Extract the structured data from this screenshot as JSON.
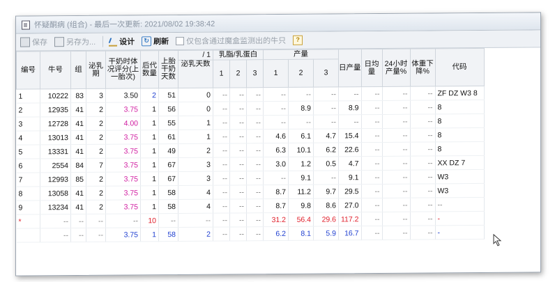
{
  "window": {
    "title": "怀疑酮病 (组合) - 最后一次更新: 2021/08/02 19:38:42"
  },
  "toolbar": {
    "save": "保存",
    "saveas": "另存为...",
    "design": "设计",
    "refresh": "刷新",
    "filter": "仅包含通过魔盒监测出的牛只",
    "help_icon": "question-mark"
  },
  "headers": {
    "bianhao": "编号",
    "niuhao": "牛号",
    "zu": "组",
    "miru": "泌乳期",
    "ganpi": "干奶时体况评分(上一胎次)",
    "houdai": "后代数量",
    "shangtai": "上胎干奶天数",
    "slash": "/ 1",
    "miru_days": "泌乳天数",
    "ratio_group": "乳脂/乳蛋白",
    "yield_group": "产量",
    "sub": [
      "1",
      "2",
      "3"
    ],
    "richan": "日产量",
    "rijun": "日均量",
    "h24": "24小时产量%",
    "tizhong": "体重下降%",
    "daima": "代码"
  },
  "rows": [
    {
      "no": "1",
      "cow": "10222",
      "grp": "83",
      "lac": "3",
      "bcs": "3.50",
      "off": "2",
      "dry": "51",
      "dim": "0",
      "r1": "--",
      "r2": "--",
      "r3": "--",
      "p1": "--",
      "p2": "--",
      "p3": "--",
      "day": "--",
      "avg": "--",
      "h24": "--",
      "wt": "--",
      "code": "ZF DZ W3 8",
      "bcsColor": "black",
      "offColor": "magenta"
    },
    {
      "no": "2",
      "cow": "12935",
      "grp": "41",
      "lac": "2",
      "bcs": "3.75",
      "off": "1",
      "dry": "56",
      "dim": "0",
      "r1": "--",
      "r2": "--",
      "r3": "--",
      "p1": "--",
      "p2": "8.9",
      "p3": "--",
      "day": "8.9",
      "avg": "--",
      "h24": "--",
      "wt": "--",
      "code": "8",
      "bcsColor": "magenta",
      "offColor": "black"
    },
    {
      "no": "3",
      "cow": "12728",
      "grp": "41",
      "lac": "2",
      "bcs": "4.00",
      "off": "1",
      "dry": "55",
      "dim": "1",
      "r1": "--",
      "r2": "--",
      "r3": "--",
      "p1": "--",
      "p2": "--",
      "p3": "--",
      "day": "--",
      "avg": "--",
      "h24": "--",
      "wt": "--",
      "code": "8",
      "bcsColor": "magenta",
      "offColor": "black"
    },
    {
      "no": "4",
      "cow": "13013",
      "grp": "41",
      "lac": "2",
      "bcs": "3.75",
      "off": "1",
      "dry": "61",
      "dim": "1",
      "r1": "--",
      "r2": "--",
      "r3": "--",
      "p1": "4.6",
      "p2": "6.1",
      "p3": "4.7",
      "day": "15.4",
      "avg": "--",
      "h24": "--",
      "wt": "--",
      "code": "8",
      "bcsColor": "magenta",
      "offColor": "black"
    },
    {
      "no": "5",
      "cow": "13331",
      "grp": "41",
      "lac": "2",
      "bcs": "3.75",
      "off": "1",
      "dry": "49",
      "dim": "2",
      "r1": "--",
      "r2": "--",
      "r3": "--",
      "p1": "6.3",
      "p2": "10.1",
      "p3": "6.2",
      "day": "22.6",
      "avg": "--",
      "h24": "--",
      "wt": "--",
      "code": "8",
      "bcsColor": "magenta",
      "offColor": "black"
    },
    {
      "no": "6",
      "cow": "2554",
      "grp": "84",
      "lac": "7",
      "bcs": "3.75",
      "off": "1",
      "dry": "67",
      "dim": "3",
      "r1": "--",
      "r2": "--",
      "r3": "--",
      "p1": "3.0",
      "p2": "1.2",
      "p3": "0.5",
      "day": "4.7",
      "avg": "--",
      "h24": "--",
      "wt": "--",
      "code": "XX DZ 7",
      "bcsColor": "magenta",
      "offColor": "black"
    },
    {
      "no": "7",
      "cow": "12993",
      "grp": "85",
      "lac": "2",
      "bcs": "3.75",
      "off": "1",
      "dry": "67",
      "dim": "3",
      "r1": "--",
      "r2": "--",
      "r3": "--",
      "p1": "--",
      "p2": "9.1",
      "p3": "--",
      "day": "9.1",
      "avg": "--",
      "h24": "--",
      "wt": "--",
      "code": "W3",
      "bcsColor": "magenta",
      "offColor": "black"
    },
    {
      "no": "8",
      "cow": "13058",
      "grp": "41",
      "lac": "2",
      "bcs": "3.75",
      "off": "1",
      "dry": "58",
      "dim": "4",
      "r1": "--",
      "r2": "--",
      "r3": "--",
      "p1": "8.7",
      "p2": "11.2",
      "p3": "9.7",
      "day": "29.5",
      "avg": "--",
      "h24": "--",
      "wt": "--",
      "code": "W3",
      "bcsColor": "magenta",
      "offColor": "black"
    },
    {
      "no": "9",
      "cow": "13234",
      "grp": "41",
      "lac": "2",
      "bcs": "3.75",
      "off": "1",
      "dry": "58",
      "dim": "4",
      "r1": "--",
      "r2": "--",
      "r3": "--",
      "p1": "8.7",
      "p2": "9.8",
      "p3": "8.6",
      "day": "27.0",
      "avg": "--",
      "h24": "--",
      "wt": "--",
      "code": "--",
      "bcsColor": "magenta",
      "offColor": "black"
    }
  ],
  "summary": {
    "total": {
      "no": "*",
      "cow": "--",
      "grp": "--",
      "lac": "--",
      "bcs": "--",
      "off": "10",
      "dry": "--",
      "dim": "--",
      "r1": "--",
      "r2": "--",
      "r3": "--",
      "p1": "31.2",
      "p2": "56.4",
      "p3": "29.6",
      "day": "117.2",
      "avg": "--",
      "h24": "--",
      "wt": "--",
      "code": "-"
    },
    "average": {
      "no": "",
      "cow": "--",
      "grp": "--",
      "lac": "--",
      "bcs": "3.75",
      "off": "1",
      "dry": "58",
      "dim": "2",
      "r1": "--",
      "r2": "--",
      "r3": "--",
      "p1": "6.2",
      "p2": "8.1",
      "p3": "5.9",
      "day": "16.7",
      "avg": "--",
      "h24": "--",
      "wt": "--",
      "code": "-"
    }
  },
  "colors": {
    "magenta": "#d01ca0",
    "red": "#e0202c",
    "blue": "#1f3fd0"
  }
}
